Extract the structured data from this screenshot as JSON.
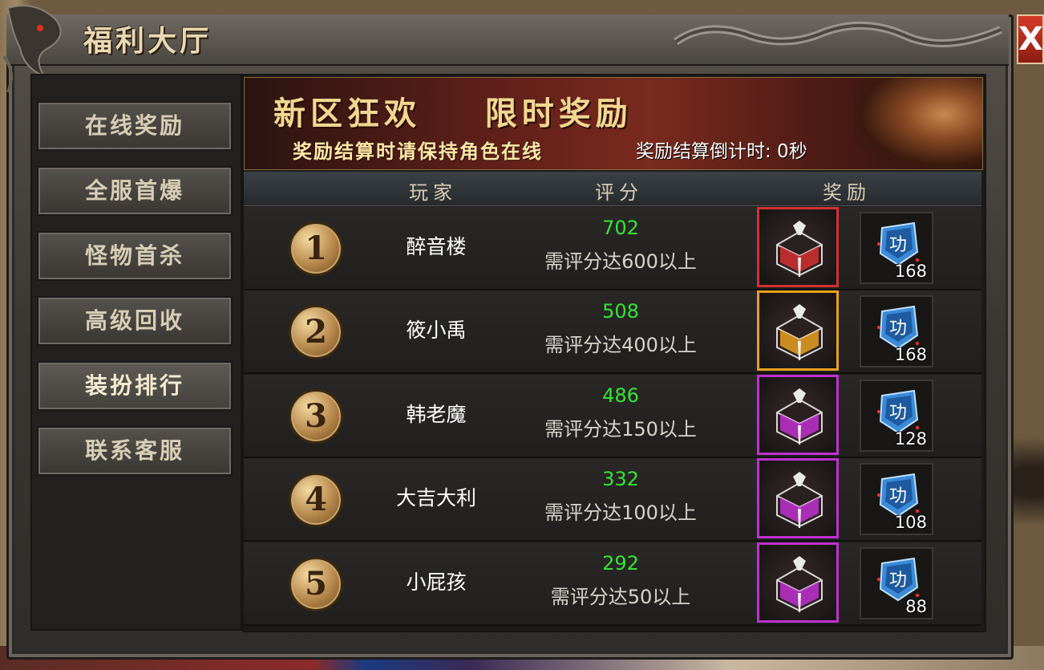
{
  "window": {
    "title": "福利大厅",
    "close_label": "X"
  },
  "sidebar": {
    "items": [
      {
        "label": "在线奖励"
      },
      {
        "label": "全服首爆"
      },
      {
        "label": "怪物首杀"
      },
      {
        "label": "高级回收"
      },
      {
        "label": "装扮排行",
        "active": true
      },
      {
        "label": "联系客服"
      }
    ]
  },
  "banner": {
    "headline": "新区狂欢    限时奖励",
    "subline": "奖励结算时请保持角色在线",
    "countdown": "奖励结算倒计时: 0秒"
  },
  "table": {
    "headers": {
      "player": "玩家",
      "score": "评分",
      "reward": "奖励"
    },
    "rows": [
      {
        "rank": "1",
        "player": "醉音楼",
        "score": "702",
        "requirement": "需评分达600以上",
        "chest_color": "#d43030",
        "chest_icon": "treasure-chest-red-icon",
        "item_icon": "merit-token-icon",
        "item_qty": "168"
      },
      {
        "rank": "2",
        "player": "筱小禹",
        "score": "508",
        "requirement": "需评分达400以上",
        "chest_color": "#e8a020",
        "chest_icon": "treasure-chest-orange-icon",
        "item_icon": "merit-token-icon",
        "item_qty": "168"
      },
      {
        "rank": "3",
        "player": "韩老魔",
        "score": "486",
        "requirement": "需评分达150以上",
        "chest_color": "#c030d0",
        "chest_icon": "treasure-chest-purple-icon",
        "item_icon": "merit-token-icon",
        "item_qty": "128"
      },
      {
        "rank": "4",
        "player": "大吉大利",
        "score": "332",
        "requirement": "需评分达100以上",
        "chest_color": "#c030d0",
        "chest_icon": "treasure-chest-purple-icon",
        "item_icon": "merit-token-icon",
        "item_qty": "108"
      },
      {
        "rank": "5",
        "player": "小屁孩",
        "score": "292",
        "requirement": "需评分达50以上",
        "chest_color": "#c030d0",
        "chest_icon": "treasure-chest-purple-icon",
        "item_icon": "merit-token-icon",
        "item_qty": "88"
      }
    ]
  },
  "colors": {
    "score_green": "#33e633",
    "title_gold": "#e9d9b3",
    "banner_gold": "#f0d890"
  }
}
